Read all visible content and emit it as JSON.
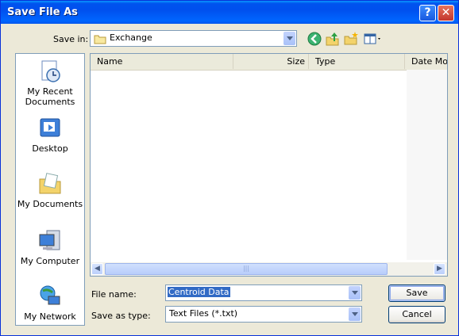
{
  "window": {
    "title": "Save File As"
  },
  "titlebar": {
    "help_label": "?",
    "close_label": "✕"
  },
  "savein": {
    "label": "Save in:",
    "value": "Exchange"
  },
  "places": [
    {
      "label": "My Recent Documents",
      "icon": "recent-documents-icon"
    },
    {
      "label": "Desktop",
      "icon": "desktop-icon"
    },
    {
      "label": "My Documents",
      "icon": "my-documents-icon"
    },
    {
      "label": "My Computer",
      "icon": "my-computer-icon"
    },
    {
      "label": "My Network",
      "icon": "my-network-icon"
    }
  ],
  "filelist": {
    "columns": [
      "Name",
      "Size",
      "Type",
      "Date Mo"
    ],
    "rows": [],
    "scroll_grip": "|||"
  },
  "filename": {
    "label": "File name:",
    "value": "Centroid Data"
  },
  "filetype": {
    "label": "Save as type:",
    "value": "Text Files (*.txt)"
  },
  "buttons": {
    "save": "Save",
    "cancel": "Cancel"
  },
  "colors": {
    "titlebar": "#0054E3",
    "dialog": "#ECE9D8",
    "selection": "#316AC5"
  }
}
